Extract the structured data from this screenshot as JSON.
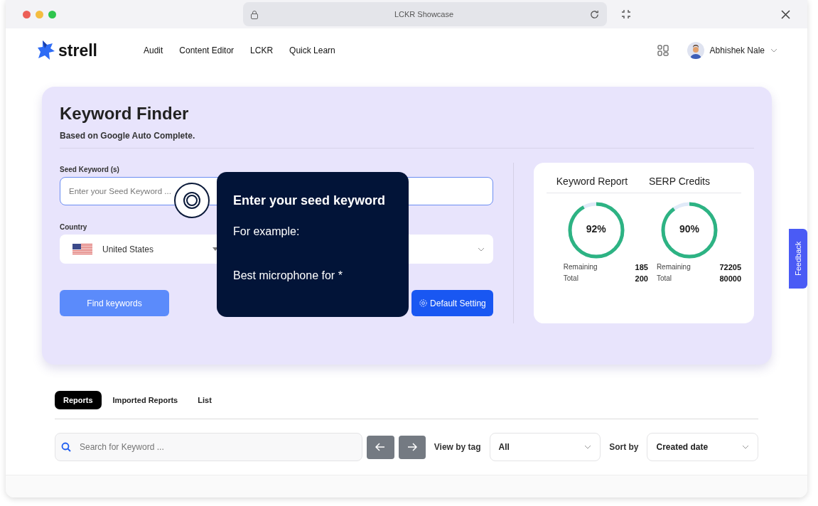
{
  "browser": {
    "title": "LCKR Showcase"
  },
  "nav": {
    "brand": "strell",
    "links": [
      "Audit",
      "Content Editor",
      "LCKR",
      "Quick Learn"
    ],
    "user": "Abhishek Nale"
  },
  "finder": {
    "title": "Keyword Finder",
    "subtitle": "Based on Google Auto Complete.",
    "seed": {
      "label": "Seed Keyword (s)",
      "placeholder": "Enter your Seed Keyword ..."
    },
    "country": {
      "label": "Country",
      "value": "United States"
    },
    "find_button": "Find keywords",
    "settings_button": "Default Setting"
  },
  "tooltip": {
    "title": "Enter your seed keyword",
    "lines": [
      "For example:",
      "Best microphone for *"
    ]
  },
  "credits": {
    "headings": [
      "Keyword Report",
      "SERP Credits"
    ],
    "meters": [
      {
        "reading": "92%",
        "level": 0.92,
        "remaining_label": "Remaining",
        "remaining": "185",
        "total_label": "Total",
        "total": "200"
      },
      {
        "reading": "90%",
        "level": 0.9,
        "remaining_label": "Remaining",
        "remaining": "72205",
        "total_label": "Total",
        "total": "80000"
      }
    ]
  },
  "feedback": "Feedback",
  "reports": {
    "tabs": [
      {
        "label": "Reports",
        "selected": true
      },
      {
        "label": "Imported Reports",
        "selected": false
      },
      {
        "label": "List",
        "selected": false
      }
    ],
    "search": {
      "placeholder": "Search for Keyword ..."
    },
    "tag_label": "View by tag",
    "tag_value": "All",
    "sort_label": "Sort by",
    "sort_value": "Created date"
  }
}
